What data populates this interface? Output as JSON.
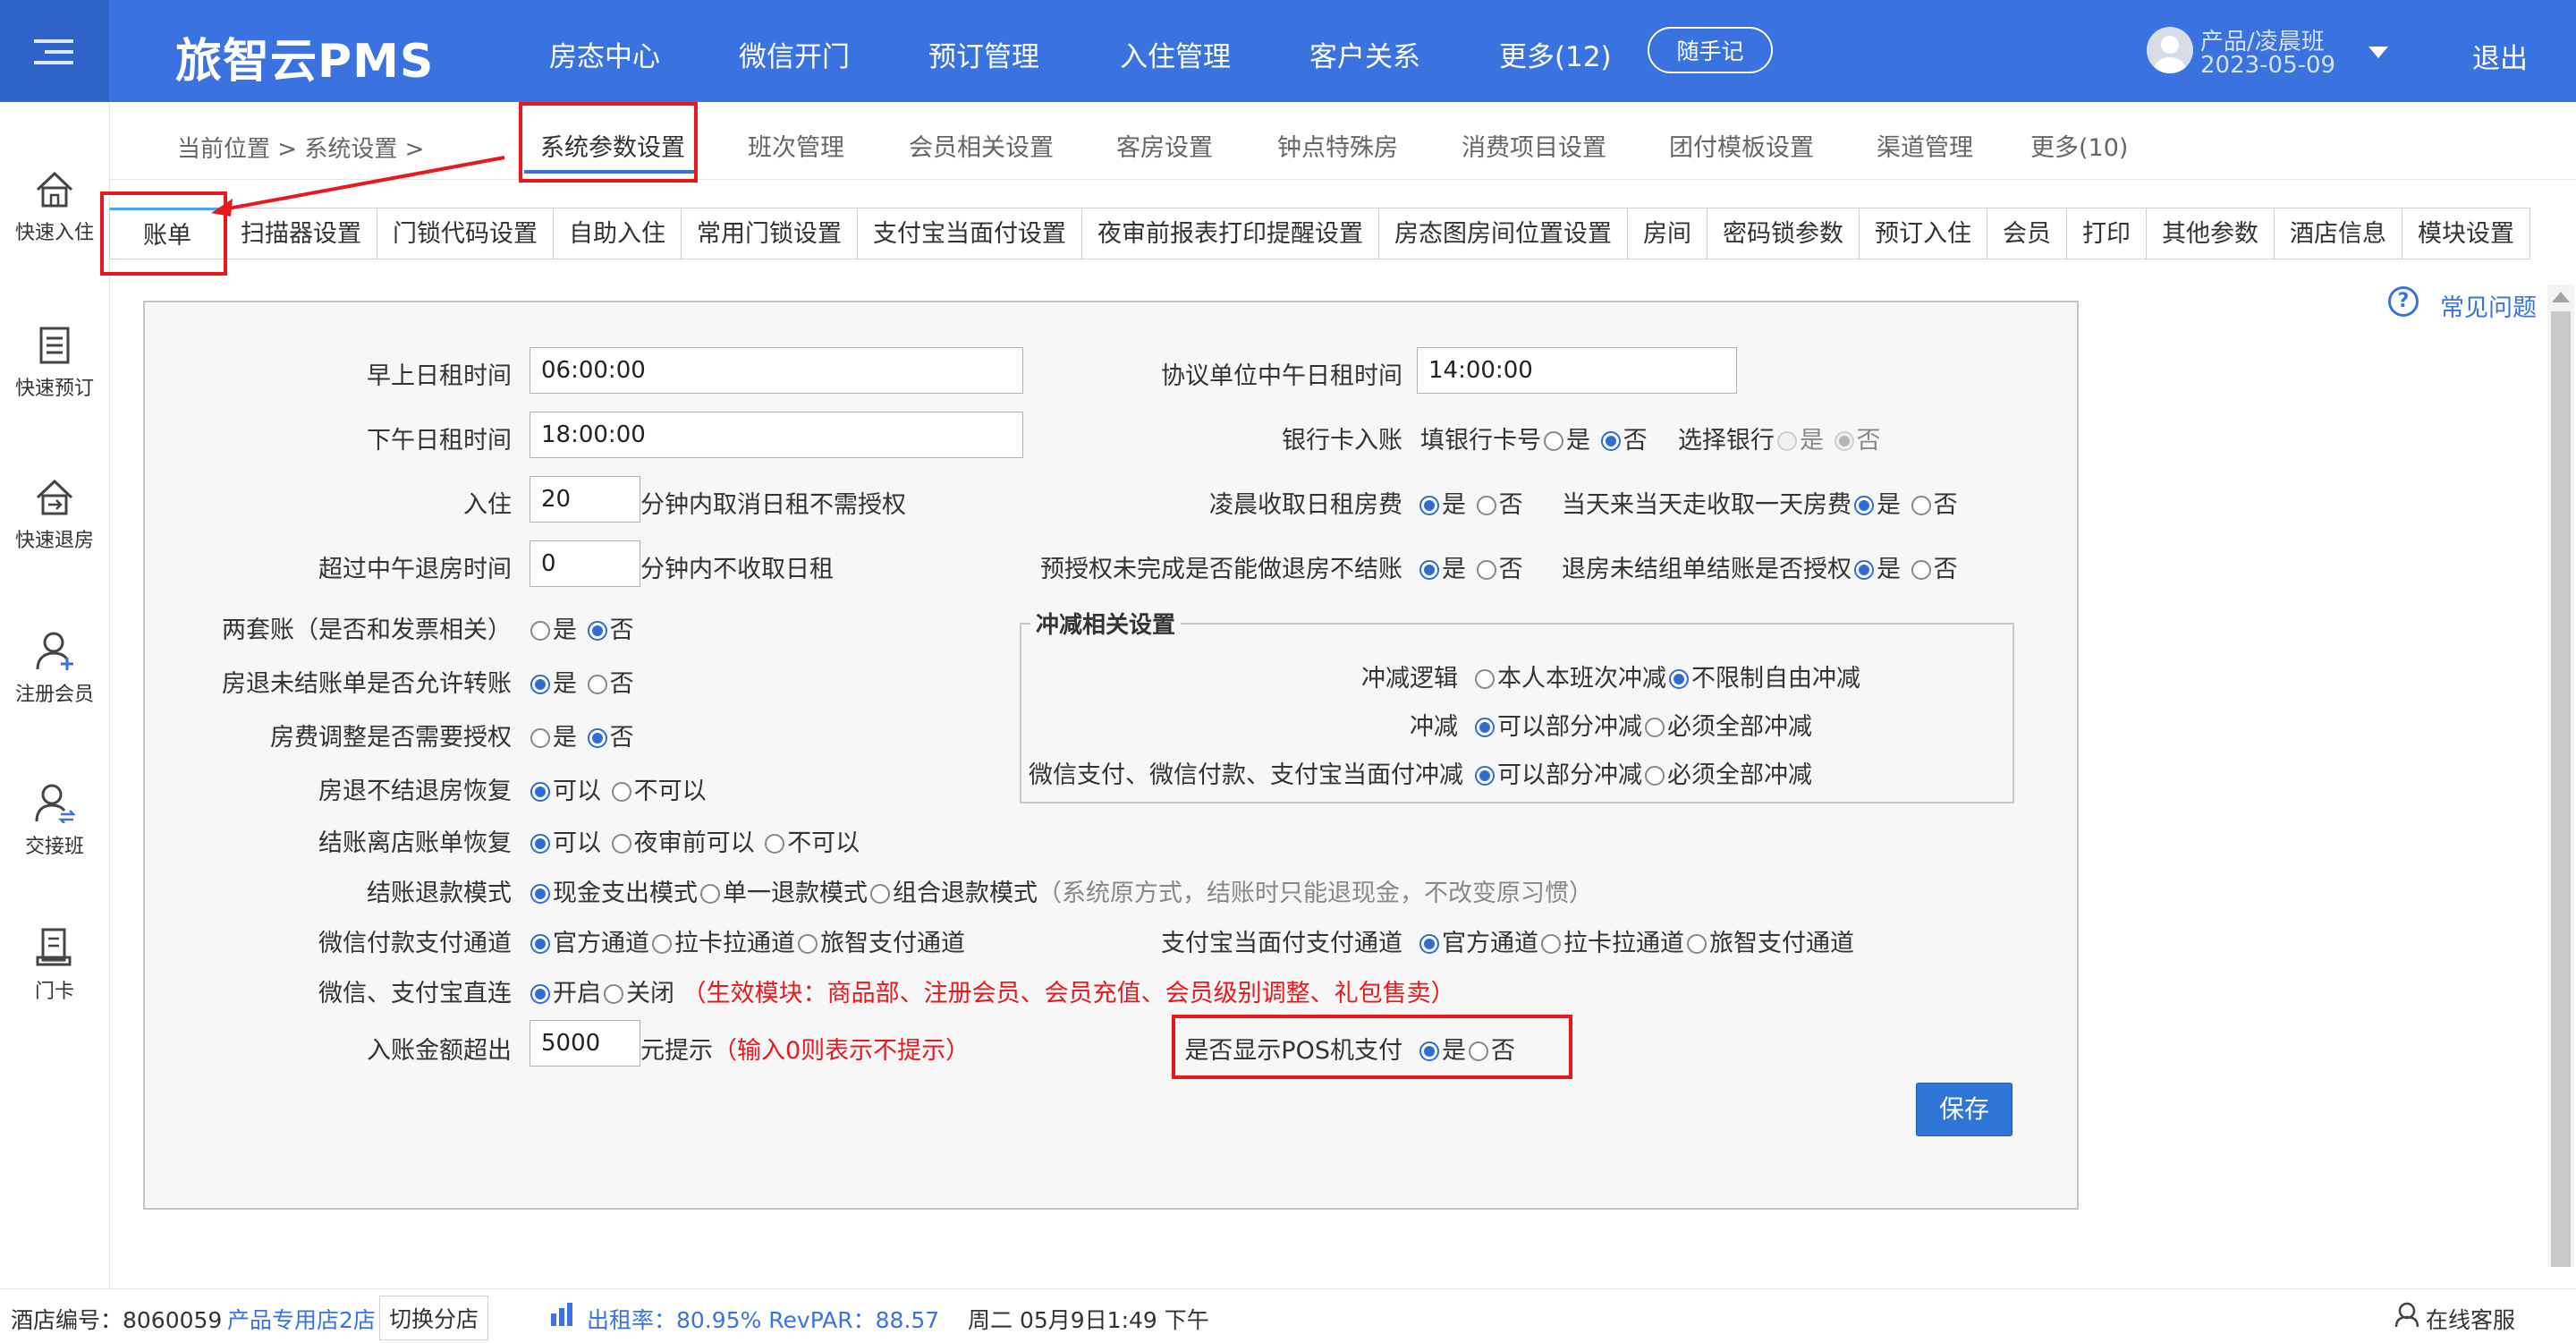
{
  "header": {
    "brand": "旅智云PMS",
    "nav": [
      "房态中心",
      "微信开门",
      "预订管理",
      "入住管理",
      "客户关系",
      "更多(12)"
    ],
    "note_button": "随手记",
    "user_name": "产品/凌晨班",
    "user_date": "2023-05-09",
    "logout": "退出"
  },
  "sidebar": {
    "items": [
      {
        "label": "快速入住",
        "icon": "house-icon"
      },
      {
        "label": "快速预订",
        "icon": "list-icon"
      },
      {
        "label": "快速退房",
        "icon": "checkout-icon"
      },
      {
        "label": "注册会员",
        "icon": "add-user-icon"
      },
      {
        "label": "交接班",
        "icon": "handover-icon"
      },
      {
        "label": "门卡",
        "icon": "card-icon"
      }
    ]
  },
  "breadcrumb": {
    "prefix": "当前位置 > 系统设置 >"
  },
  "settings_tabs": [
    "系统参数设置",
    "班次管理",
    "会员相关设置",
    "客房设置",
    "钟点特殊房",
    "消费项目设置",
    "团付模板设置",
    "渠道管理",
    "更多(10)"
  ],
  "sub_tabs": [
    "账单",
    "扫描器设置",
    "门锁代码设置",
    "自助入住",
    "常用门锁设置",
    "支付宝当面付设置",
    "夜审前报表打印提醒设置",
    "房态图房间位置设置",
    "房间",
    "密码锁参数",
    "预订入住",
    "会员",
    "打印",
    "其他参数",
    "酒店信息",
    "模块设置"
  ],
  "help": {
    "label": "常见问题"
  },
  "form": {
    "morning_rent_label": "早上日租时间",
    "morning_rent_value": "06:00:00",
    "afternoon_rent_label": "下午日租时间",
    "afternoon_rent_value": "18:00:00",
    "checkin_label": "入住",
    "checkin_value": "20",
    "checkin_suffix": "分钟内取消日租不需授权",
    "noon_checkout_label": "超过中午退房时间",
    "noon_checkout_value": "0",
    "noon_checkout_suffix": "分钟内不收取日租",
    "two_accounts_label": "两套账（是否和发票相关）",
    "unsettled_transfer_label": "房退未结账单是否允许转账",
    "fee_adjust_label": "房费调整是否需要授权",
    "restore_unsettled_label": "房退不结退房恢复",
    "restore_settled_label": "结账离店账单恢复",
    "refund_mode_label": "结账退款模式",
    "refund_mode_options": [
      "现金支出模式",
      "单一退款模式",
      "组合退款模式"
    ],
    "refund_mode_note": "（系统原方式，结账时只能退现金，不改变原习惯）",
    "wechat_channel_label": "微信付款支付通道",
    "channel_options": [
      "官方通道",
      "拉卡拉通道",
      "旅智支付通道"
    ],
    "direct_label": "微信、支付宝直连",
    "direct_on": "开启",
    "direct_off": "关闭",
    "direct_note": "（生效模块：商品部、注册会员、会员充值、会员级别调整、礼包售卖）",
    "amount_label": "入账金额超出",
    "amount_value": "5000",
    "amount_suffix": "元提示",
    "amount_note": "（输入0则表示不提示）",
    "agreement_noon_label": "协议单位中午日租时间",
    "agreement_noon_value": "14:00:00",
    "bank_card_label": "银行卡入账",
    "fill_bank_card": "填银行卡号",
    "choose_bank": "选择银行",
    "early_charge_label": "凌晨收取日租房费",
    "same_day_label": "当天来当天走收取一天房费",
    "preauth_label": "预授权未完成是否能做退房不结账",
    "unsettled_group_label": "退房未结组单结账是否授权",
    "alipay_channel_label": "支付宝当面付支付通道",
    "pos_label": "是否显示POS机支付",
    "yes": "是",
    "no": "否",
    "can": "可以",
    "cannot": "不可以",
    "before_audit": "夜审前可以",
    "save": "保存"
  },
  "offset_group": {
    "title": "冲减相关设置",
    "logic_label": "冲减逻辑",
    "logic_options": [
      "本人本班次冲减",
      "不限制自由冲减"
    ],
    "offset_label": "冲减",
    "offset_options": [
      "可以部分冲减",
      "必须全部冲减"
    ],
    "wechat_offset_label": "微信支付、微信付款、支付宝当面付冲减"
  },
  "status_bar": {
    "hotel_no": "酒店编号：8060059",
    "store": "产品专用店2店",
    "switch": "切换分店",
    "occupancy": "出租率：80.95%  RevPAR：88.57",
    "datetime": "周二 05月9日1:49 下午",
    "service": "在线客服"
  },
  "colors": {
    "topbar": "#3a73df",
    "annotation": "#e8191c",
    "primary_button": "#2f75d6"
  }
}
